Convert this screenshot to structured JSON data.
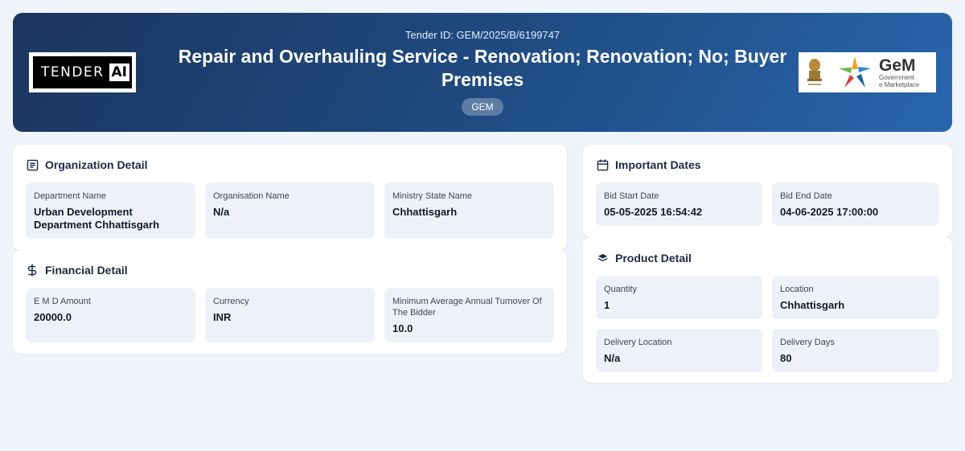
{
  "header": {
    "tender_id": "Tender ID: GEM/2025/B/6199747",
    "title": "Repair and Overhauling Service - Renovation; Renovation; No; Buyer Premises",
    "badge": "GEM",
    "logo_left": {
      "word": "TENDER",
      "accent": "AI"
    },
    "logo_right": {
      "word": "GeM",
      "line1": "Government",
      "line2": "e Marketplace"
    }
  },
  "organization": {
    "title": "Organization Detail",
    "icon": "document-list-icon",
    "fields": [
      {
        "label": "Department Name",
        "value": "Urban Development Department Chhattisgarh"
      },
      {
        "label": "Organisation Name",
        "value": "N/a"
      },
      {
        "label": "Ministry State Name",
        "value": "Chhattisgarh"
      }
    ]
  },
  "financial": {
    "title": "Financial Detail",
    "icon": "dollar-icon",
    "fields": [
      {
        "label": "E M D Amount",
        "value": "20000.0"
      },
      {
        "label": "Currency",
        "value": "INR"
      },
      {
        "label": "Minimum Average Annual Turnover Of The Bidder",
        "value": "10.0"
      }
    ]
  },
  "dates": {
    "title": "Important Dates",
    "icon": "calendar-icon",
    "fields": [
      {
        "label": "Bid Start Date",
        "value": "05-05-2025 16:54:42"
      },
      {
        "label": "Bid End Date",
        "value": "04-06-2025 17:00:00"
      }
    ]
  },
  "product": {
    "title": "Product Detail",
    "icon": "layers-icon",
    "fields": [
      {
        "label": "Quantity",
        "value": "1"
      },
      {
        "label": "Location",
        "value": "Chhattisgarh"
      },
      {
        "label": "Delivery Location",
        "value": "N/a"
      },
      {
        "label": "Delivery Days",
        "value": "80"
      }
    ]
  }
}
